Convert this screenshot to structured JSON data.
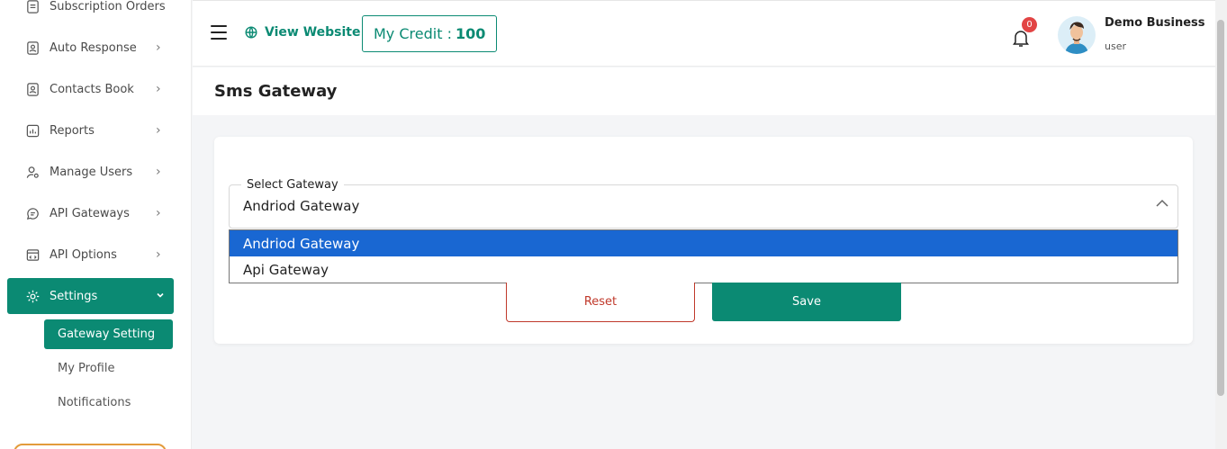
{
  "sidebar": {
    "items": [
      {
        "label": "Subscription Orders",
        "icon": "receipt-icon"
      },
      {
        "label": "Auto Response",
        "icon": "contact-card-icon"
      },
      {
        "label": "Contacts Book",
        "icon": "contact-book-icon"
      },
      {
        "label": "Reports",
        "icon": "reports-chart-icon"
      },
      {
        "label": "Manage Users",
        "icon": "user-gear-icon"
      },
      {
        "label": "API Gateways",
        "icon": "chat-bubble-icon"
      },
      {
        "label": "API Options",
        "icon": "code-window-icon"
      },
      {
        "label": "Settings",
        "icon": "gear-icon"
      }
    ],
    "submenu": [
      {
        "label": "Gateway Setting"
      },
      {
        "label": "My Profile"
      },
      {
        "label": "Notifications"
      }
    ]
  },
  "header": {
    "view_website": "View Website",
    "credit_label": "My Credit :",
    "credit_value": "100",
    "notification_count": "0",
    "user_name": "Demo Business",
    "user_role": "user"
  },
  "page": {
    "title": "Sms Gateway"
  },
  "form": {
    "gateway_label": "Select Gateway",
    "gateway_value": "Andriod Gateway",
    "options": [
      "Andriod Gateway",
      "Api Gateway"
    ],
    "reset_label": "Reset",
    "save_label": "Save"
  },
  "colors": {
    "accent": "#0b8a73",
    "select_highlight": "#1967d2",
    "danger": "#c0392b",
    "badge": "#e24444"
  }
}
